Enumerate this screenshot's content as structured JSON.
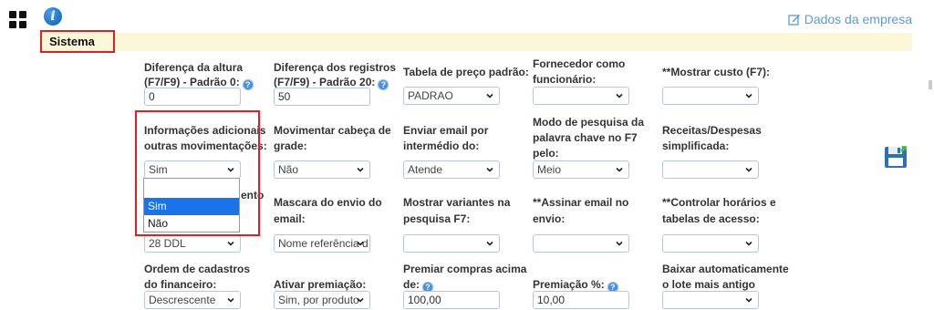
{
  "header": {
    "company_link": "Dados da empresa",
    "section_title": "Sistema"
  },
  "colors": {
    "accent": "#5b9bd5",
    "highlight": "#e02020",
    "section_bg": "#fbf7d9",
    "dropdown_selected": "#1a73e8"
  },
  "fields": {
    "dif_altura": {
      "label1": "Diferença da altura",
      "label2": "(F7/F9) - Padrão 0:",
      "value": "0"
    },
    "dif_registros": {
      "label1": "Diferença dos registros",
      "label2": "(F7/F9) - Padrão 20:",
      "value": "50"
    },
    "tabela_preco": {
      "label": "Tabela de preço padrão:",
      "value": "PADRAO"
    },
    "fornecedor": {
      "label1": "Fornecedor como",
      "label2": "funcionário:",
      "value": ""
    },
    "mostrar_custo": {
      "label": "**Mostrar custo (F7):",
      "value": ""
    },
    "info_adicionais": {
      "label1": "Informações adicionais",
      "label2": "outras movimentações:",
      "value": "Sim"
    },
    "movimentar_cabeca": {
      "label1": "Movimentar cabeça de",
      "label2": "grade:",
      "value": "Não"
    },
    "enviar_email": {
      "label1": "Enviar email por",
      "label2": "intermédio do:",
      "value": "Atende"
    },
    "modo_pesquisa": {
      "label1": "Modo de pesquisa da",
      "label2": "palavra chave no F7",
      "label3": "pelo:",
      "value": "Meio"
    },
    "receitas": {
      "label1": "Receitas/Despesas",
      "label2": "simplificada:",
      "value": ""
    },
    "row3_col1": {
      "label_partial": "ento",
      "value": "28 DDL"
    },
    "mascara_envio": {
      "label1": "Mascara do envio do",
      "label2": "email:",
      "value": "Nome referência d"
    },
    "mostrar_variantes": {
      "label1": "Mostrar variantes na",
      "label2": "pesquisa F7:",
      "value": ""
    },
    "assinar_email": {
      "label1": "**Assinar email no",
      "label2": "envio:",
      "value": ""
    },
    "controlar_horarios": {
      "label1": "**Controlar horários e",
      "label2": "tabelas de acesso:",
      "value": ""
    },
    "ordem_cadastros": {
      "label1": "Ordem de cadastros",
      "label2": "do financeiro:",
      "value": "Descrescente"
    },
    "ativar_premiacao": {
      "label": "Ativar premiação:",
      "value": "Sim, por produto"
    },
    "premiar_compras": {
      "label1": "Premiar compras acima",
      "label2": "de:",
      "value": "100,00"
    },
    "premiacao_pct": {
      "label": "Premiação %:",
      "value": "10,00"
    },
    "baixar_lote": {
      "label1": "Baixar automaticamente",
      "label2": "o lote mais antigo",
      "value": ""
    }
  },
  "dropdown_open": {
    "options": [
      "Sim",
      "Não"
    ],
    "selected": "Sim"
  },
  "icons": {
    "grid": "grid-icon",
    "info": "info-icon",
    "edit": "edit-icon",
    "help": "help-icon",
    "save": "save-icon"
  }
}
